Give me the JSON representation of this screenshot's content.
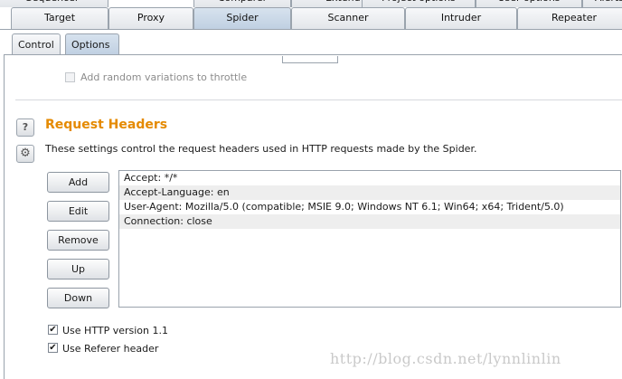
{
  "top_tabs_row0": [
    "Sequencer",
    "Comparer",
    "Extender",
    "Project options",
    "User options",
    "Alerts"
  ],
  "top_tabs_row1": [
    "Target",
    "Proxy",
    "Spider",
    "Scanner",
    "Intruder",
    "Repeater"
  ],
  "selected_top_tab": "Spider",
  "sub_tabs": [
    "Control",
    "Options"
  ],
  "selected_sub_tab": "Options",
  "throttle_option": {
    "label": "Add random variations to throttle",
    "checked": false,
    "enabled": false
  },
  "request_headers": {
    "title": "Request Headers",
    "description": "These settings control the request headers used in HTTP requests made by the Spider.",
    "help_icon": "question-icon",
    "settings_icon": "gear-icon",
    "buttons": [
      "Add",
      "Edit",
      "Remove",
      "Up",
      "Down"
    ],
    "headers": [
      "Accept: */*",
      "Accept-Language: en",
      "User-Agent: Mozilla/5.0 (compatible; MSIE 9.0; Windows NT 6.1; Win64; x64; Trident/5.0)",
      "Connection: close"
    ]
  },
  "options": [
    {
      "label": "Use HTTP version 1.1",
      "checked": true
    },
    {
      "label": "Use Referer header",
      "checked": true
    }
  ],
  "watermark": "http://blog.csdn.net/lynnlinlin",
  "colors": {
    "section_title": "#e58a00",
    "selected_tab": "#c8d6e6"
  }
}
